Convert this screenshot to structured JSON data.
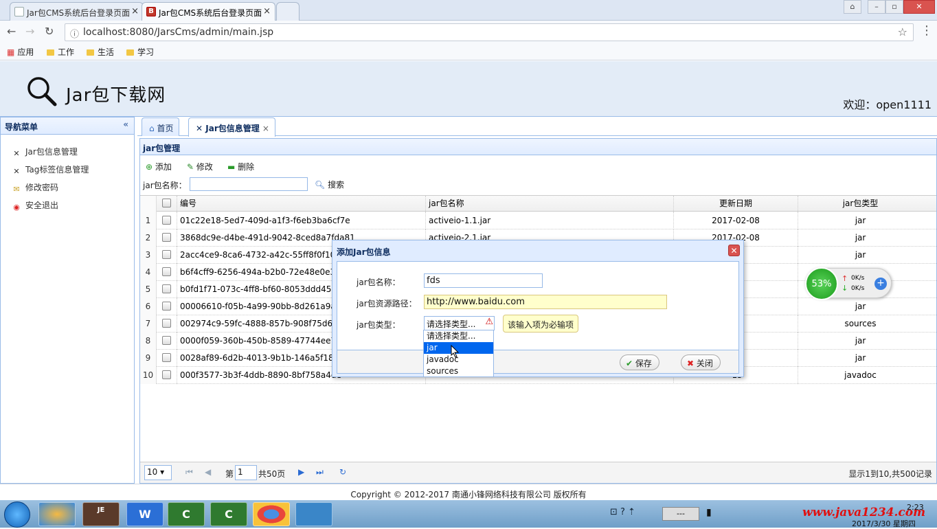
{
  "browser": {
    "tabs": [
      {
        "title": "Jar包CMS系统后台登录页面"
      },
      {
        "title": "Jar包CMS系统后台登录页面"
      }
    ],
    "url": "localhost:8080/JarsCms/admin/main.jsp",
    "bookmarks": [
      "应用",
      "工作",
      "生活",
      "学习"
    ]
  },
  "header": {
    "site_title": "Jar包下载网",
    "welcome": "欢迎：open1111"
  },
  "sidebar": {
    "title": "导航菜单",
    "items": [
      {
        "label": "Jar包信息管理",
        "icon": "tools-icon"
      },
      {
        "label": "Tag标签信息管理",
        "icon": "tools-icon"
      },
      {
        "label": "修改密码",
        "icon": "key-icon"
      },
      {
        "label": "安全退出",
        "icon": "exit-icon"
      }
    ]
  },
  "tabs": [
    {
      "label": "首页"
    },
    {
      "label": "Jar包信息管理"
    }
  ],
  "panel": {
    "title": "jar包管理",
    "toolbar": {
      "add": "添加",
      "edit": "修改",
      "delete": "删除"
    },
    "search": {
      "label": "jar包名称：",
      "button": "搜索"
    },
    "columns": [
      "编号",
      "jar包名称",
      "更新日期",
      "jar包类型"
    ],
    "rows": [
      {
        "n": "1",
        "id": "01c22e18-5ed7-409d-a1f3-f6eb3ba6cf7e",
        "name": "activeio-1.1.jar",
        "date": "2017-02-08",
        "type": "jar"
      },
      {
        "n": "2",
        "id": "3868dc9e-d4be-491d-9042-8ced8a7fda81",
        "name": "activeio-2.1.jar",
        "date": "2017-02-08",
        "type": "jar"
      },
      {
        "n": "3",
        "id": "2acc4ce9-8ca6-4732-a42c-55ff8f0f106",
        "name": "",
        "date": "-08",
        "type": "jar"
      },
      {
        "n": "4",
        "id": "b6f4cff9-6256-494a-b2b0-72e48e0e33",
        "name": "",
        "date": "-08",
        "type": "jar"
      },
      {
        "n": "5",
        "id": "b0fd1f71-073c-4ff8-bf60-8053ddd457",
        "name": "",
        "date": "-08",
        "type": "jar"
      },
      {
        "n": "6",
        "id": "00006610-f05b-4a99-90bb-8d261a9aa",
        "name": "",
        "date": "-13",
        "type": "jar"
      },
      {
        "n": "7",
        "id": "002974c9-59fc-4888-857b-908f75d603",
        "name": "",
        "date": "-13",
        "type": "sources"
      },
      {
        "n": "8",
        "id": "0000f059-360b-450b-8589-47744ee79",
        "name": "",
        "date": "-13",
        "type": "jar"
      },
      {
        "n": "9",
        "id": "0028af89-6d2b-4013-9b1b-146a5f18e",
        "name": "",
        "date": "-13",
        "type": "jar"
      },
      {
        "n": "10",
        "id": "000f3577-3b3f-4ddb-8890-8bf758a4de",
        "name": "",
        "date": "-13",
        "type": "javadoc"
      }
    ],
    "pager": {
      "page_size": "10",
      "page_prefix": "第",
      "page": "1",
      "total_pages": "共50页",
      "summary": "显示1到10,共500记录"
    }
  },
  "dialog": {
    "title": "添加Jar包信息",
    "name_label": "jar包名称：",
    "name_value": "fds",
    "path_label": "jar包资源路径：",
    "path_value": "http://www.baidu.com",
    "type_label": "jar包类型：",
    "type_value": "请选择类型...",
    "tooltip": "该输入项为必输项",
    "options": [
      "请选择类型...",
      "jar",
      "javadoc",
      "sources"
    ],
    "save": "保存",
    "close": "关闭"
  },
  "net_widget": {
    "percent": "53%",
    "up": "0K/s",
    "down": "0K/s"
  },
  "footer": "Copyright © 2012-2017 南通小锋网络科技有限公司 版权所有",
  "taskbar": {
    "brand": "www.java1234.com",
    "time": "2:23",
    "date": "2017/3/30 星期四"
  }
}
